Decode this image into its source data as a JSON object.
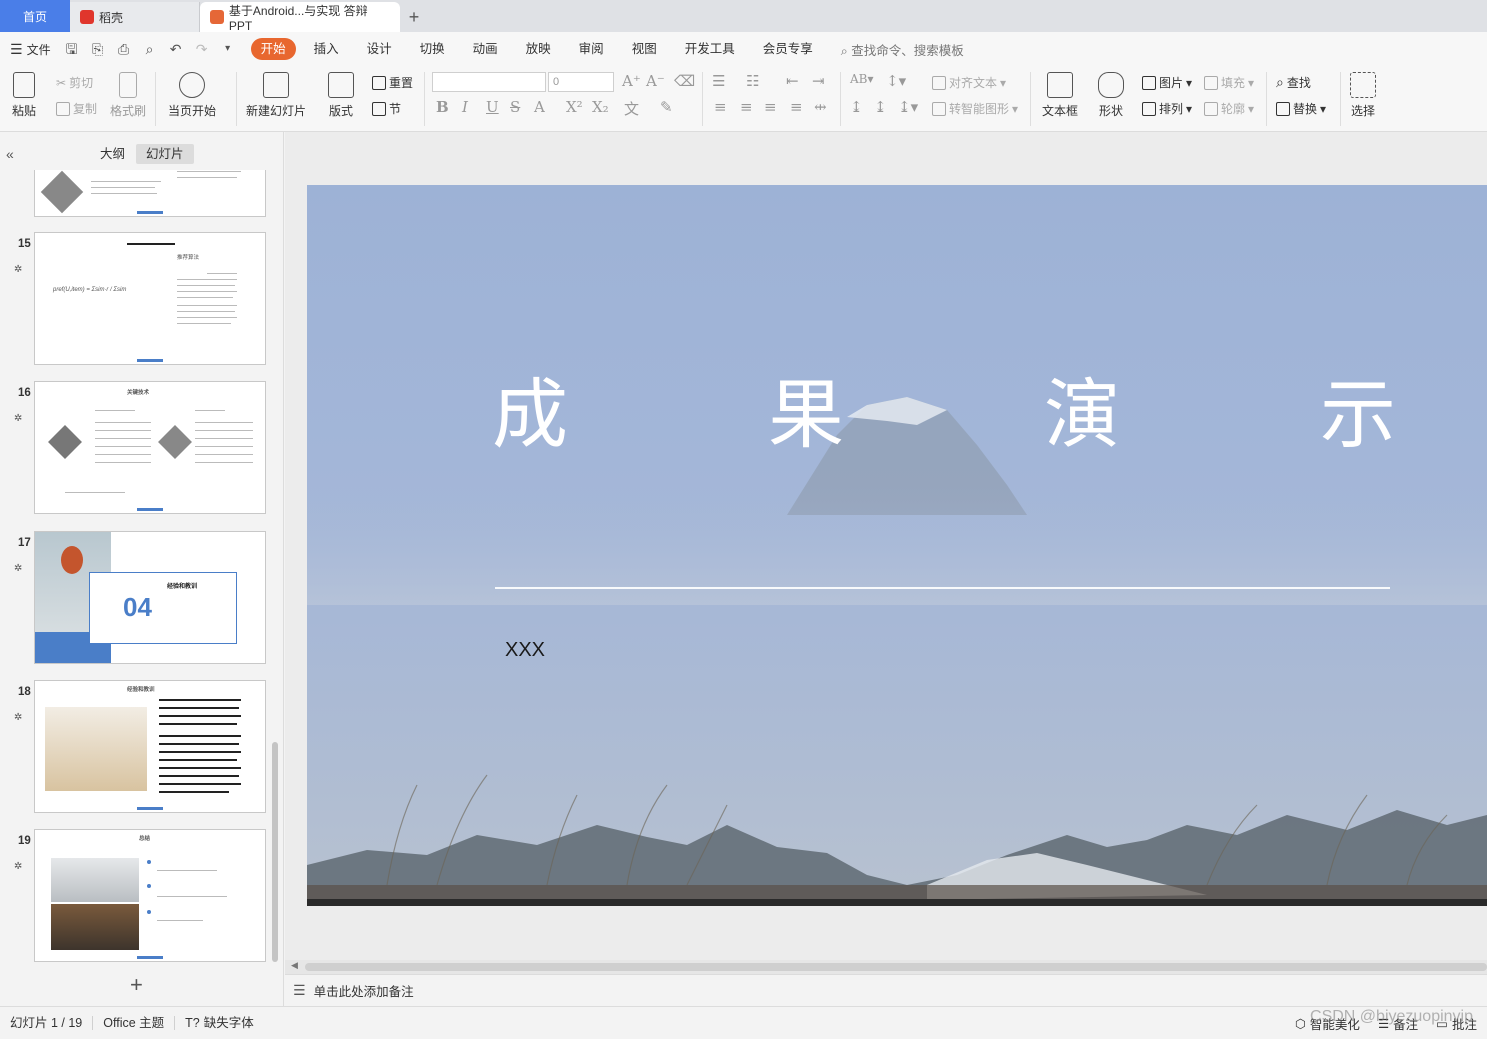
{
  "tabs": {
    "home": "首页",
    "shell": "稻壳",
    "doc": "基于Android...与实现 答辩PPT",
    "add": "+"
  },
  "menu": {
    "file": "文件",
    "items": [
      "开始",
      "插入",
      "设计",
      "切换",
      "动画",
      "放映",
      "审阅",
      "视图",
      "开发工具",
      "会员专享"
    ],
    "search": "查找命令、搜索模板"
  },
  "ribbon": {
    "paste": "粘贴",
    "cut": "剪切",
    "copy": "复制",
    "format_painter": "格式刷",
    "from_start": "当页开始",
    "new_slide": "新建幻灯片",
    "layout": "版式",
    "reset": "重置",
    "section": "节",
    "font_size": "0",
    "align_text": "对齐文本",
    "smart_art": "转智能图形",
    "textbox": "文本框",
    "shape": "形状",
    "picture": "图片",
    "arrange": "排列",
    "fill": "填充",
    "outline": "轮廓",
    "find": "查找",
    "replace": "替换",
    "select": "选择"
  },
  "left_panel": {
    "tab_outline": "大纲",
    "tab_slides": "幻灯片",
    "add_slide": "+",
    "slides": [
      {
        "num": "15",
        "title": "推荐算法"
      },
      {
        "num": "16",
        "title": "关键技术"
      },
      {
        "num": "17",
        "title": "经验和教训",
        "badge": "04"
      },
      {
        "num": "18",
        "title": "经验和教训"
      },
      {
        "num": "19",
        "title": "总结"
      }
    ]
  },
  "slide": {
    "title_chars": [
      "成",
      "果",
      "演",
      "示"
    ],
    "author": "XXX"
  },
  "notes_placeholder": "单击此处添加备注",
  "status": {
    "slide_counter": "幻灯片 1 / 19",
    "theme": "Office 主题",
    "missing_font": "缺失字体",
    "smart_beautify": "智能美化",
    "notes": "备注",
    "comments": "批注"
  },
  "watermark": "CSDN @biyezuopinvip",
  "colors": {
    "home_tab": "#4a7ee8",
    "active_menu": "#e8672f",
    "thumb_accent": "#4a7ec8"
  }
}
